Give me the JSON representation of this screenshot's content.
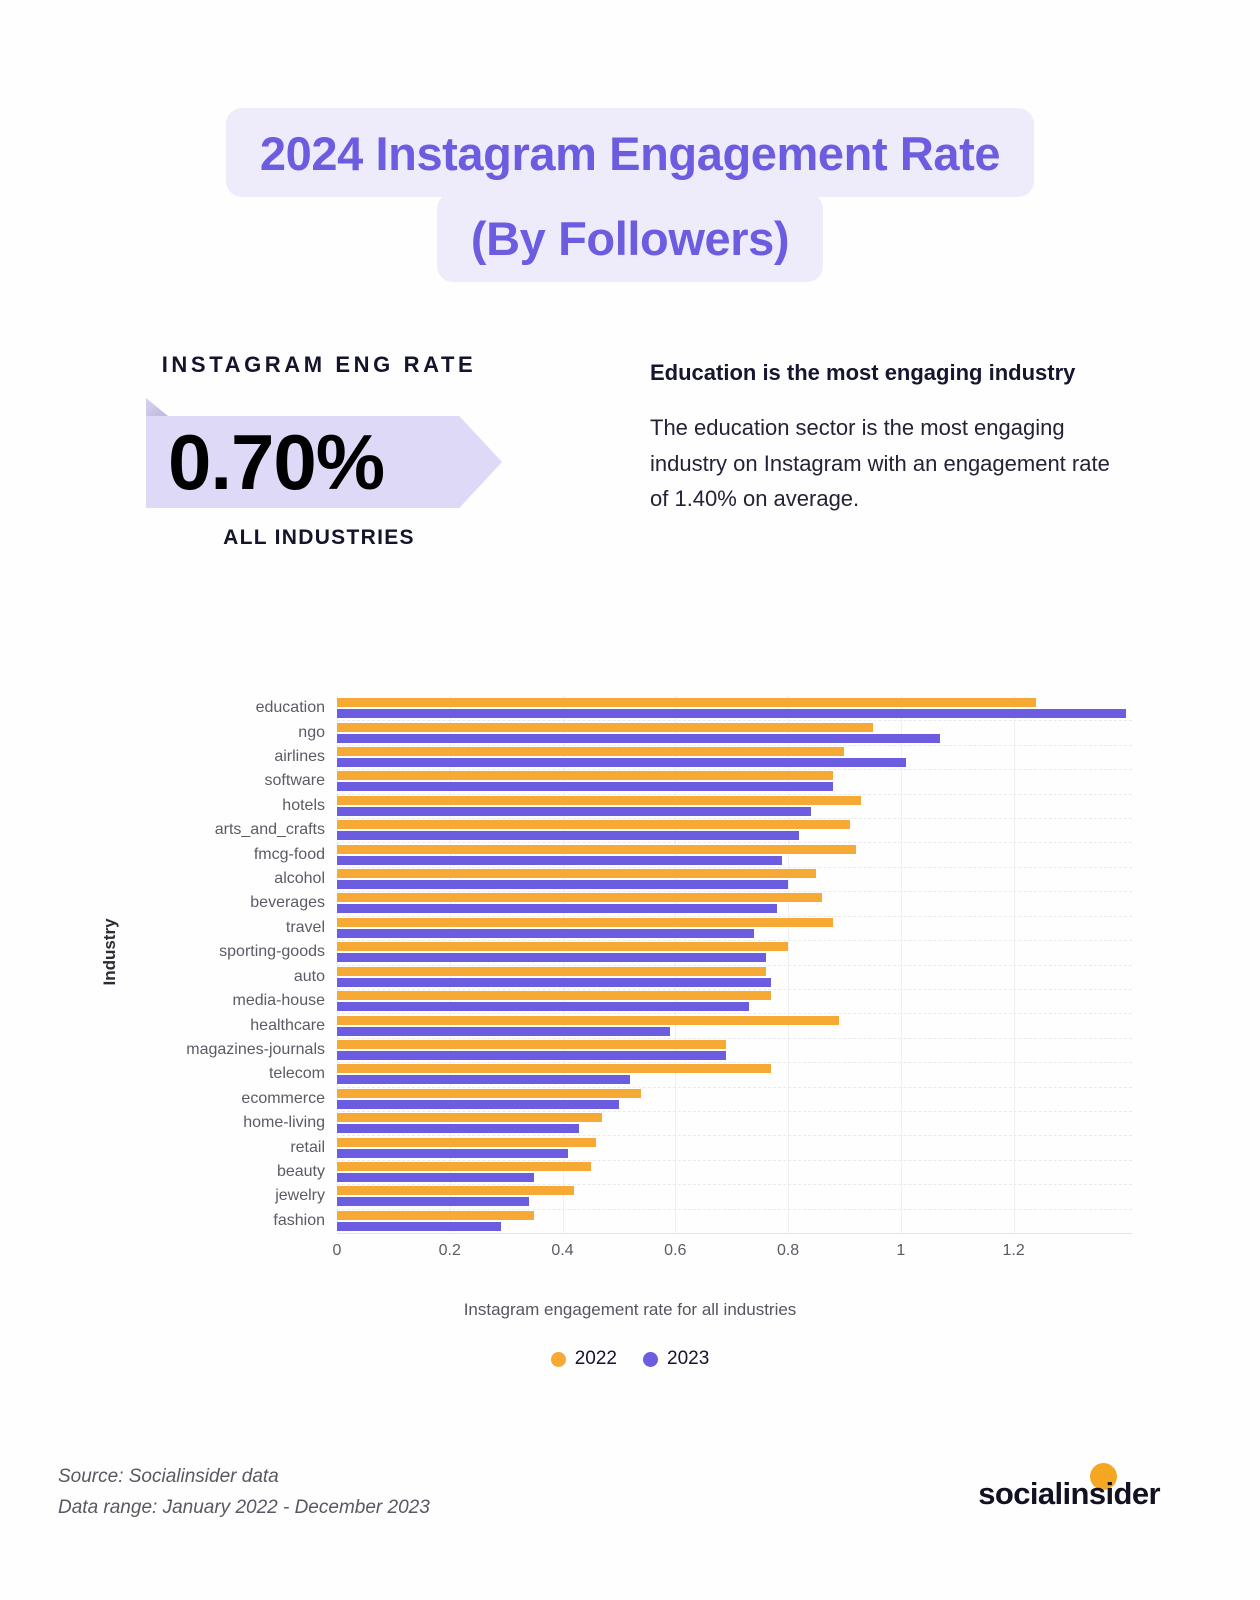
{
  "title": {
    "line1": "2024 Instagram Engagement Rate",
    "line2": "(By Followers)",
    "color": "#6c5ce0",
    "background": "#eeecfb"
  },
  "stat": {
    "kicker": "INSTAGRAM ENG RATE",
    "value": "0.70%",
    "sublabel": "ALL INDUSTRIES",
    "ribbon_color": "#ddd9f6"
  },
  "note": {
    "heading": "Education is the most engaging industry",
    "body": "The education sector is the most engaging industry on Instagram with an engagement rate of 1.40% on average."
  },
  "footer": {
    "source": "Source: Socialinsider data",
    "range": "Data range: January 2022 - December 2023",
    "logo": "socialinsider"
  },
  "chart_data": {
    "type": "bar",
    "orientation": "horizontal",
    "title": "",
    "xlabel": "Instagram engagement rate for all industries",
    "ylabel": "Industry",
    "xlim": [
      0,
      1.41
    ],
    "xticks": [
      0,
      0.2,
      0.4,
      0.6,
      0.8,
      1,
      1.2
    ],
    "xtick_labels": [
      "0",
      "0.2",
      "0.4",
      "0.6",
      "0.8",
      "1",
      "1.2"
    ],
    "grid": true,
    "legend_position": "bottom",
    "colors": {
      "2022": "#f6a935",
      "2023": "#6c5ce0"
    },
    "categories": [
      "education",
      "ngo",
      "airlines",
      "software",
      "hotels",
      "arts_and_crafts",
      "fmcg-food",
      "alcohol",
      "beverages",
      "travel",
      "sporting-goods",
      "auto",
      "media-house",
      "healthcare",
      "magazines-journals",
      "telecom",
      "ecommerce",
      "home-living",
      "retail",
      "beauty",
      "jewelry",
      "fashion"
    ],
    "series": [
      {
        "name": "2022",
        "values": [
          1.24,
          0.95,
          0.9,
          0.88,
          0.93,
          0.91,
          0.92,
          0.85,
          0.86,
          0.88,
          0.8,
          0.76,
          0.77,
          0.89,
          0.69,
          0.77,
          0.54,
          0.47,
          0.46,
          0.45,
          0.42,
          0.35
        ]
      },
      {
        "name": "2023",
        "values": [
          1.4,
          1.07,
          1.01,
          0.88,
          0.84,
          0.82,
          0.79,
          0.8,
          0.78,
          0.74,
          0.76,
          0.77,
          0.73,
          0.59,
          0.69,
          0.52,
          0.5,
          0.43,
          0.41,
          0.35,
          0.34,
          0.29
        ]
      }
    ],
    "legend": [
      "2022",
      "2023"
    ]
  }
}
